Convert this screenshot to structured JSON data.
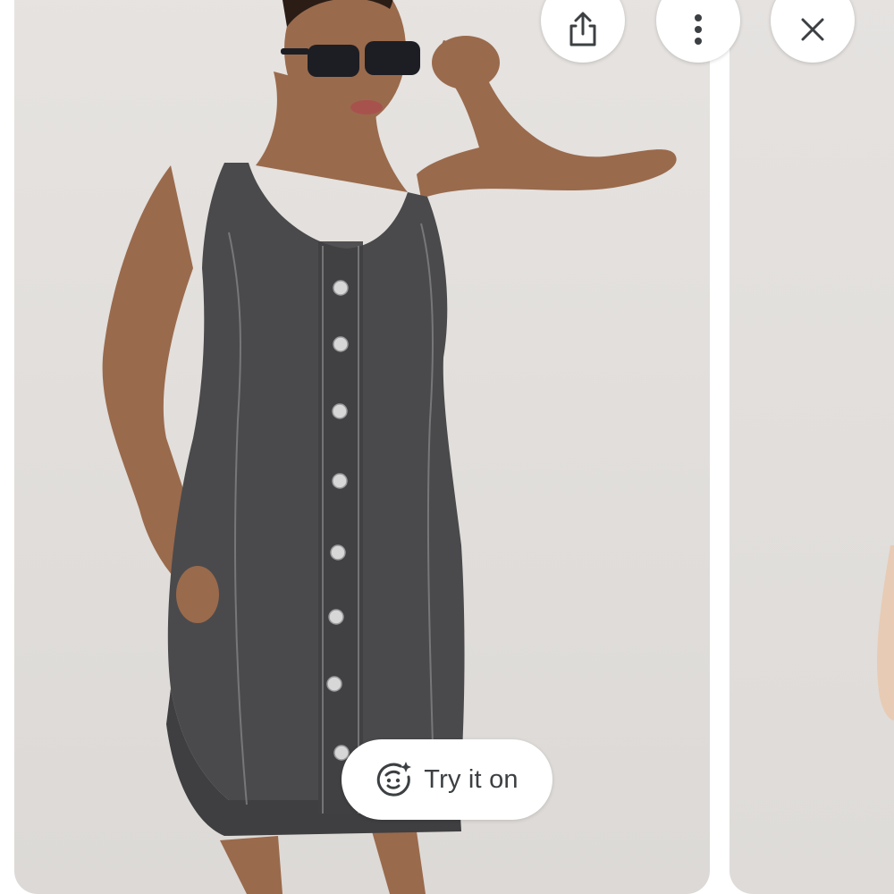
{
  "toolbar": {
    "share_icon": "share-icon",
    "more_icon": "more-vert-icon",
    "close_icon": "close-icon"
  },
  "try_on": {
    "label": "Try it on",
    "icon": "face-sparkle-icon"
  },
  "colors": {
    "button_bg": "#ffffff",
    "icon": "#3c4043",
    "card_bg": "#e2dfdc",
    "denim": "#4a4a4c"
  }
}
